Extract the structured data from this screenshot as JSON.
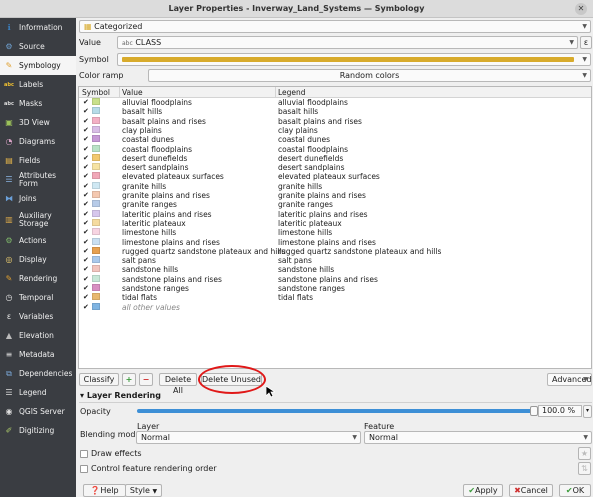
{
  "window": {
    "title": "Layer Properties - Inverway_Land_Systems — Symbology"
  },
  "sidebar": {
    "items": [
      {
        "label": "Information",
        "icon": "info-icon",
        "color": "#3b82c4"
      },
      {
        "label": "Source",
        "icon": "source-icon",
        "color": "#6fa0cf"
      },
      {
        "label": "Symbology",
        "icon": "paintbrush-icon",
        "color": "#e0a030"
      },
      {
        "label": "Labels",
        "icon": "labels-icon",
        "color": "#f0c030"
      },
      {
        "label": "Masks",
        "icon": "masks-icon",
        "color": "#dddddd"
      },
      {
        "label": "3D View",
        "icon": "cube-icon",
        "color": "#9cc25a"
      },
      {
        "label": "Diagrams",
        "icon": "diagrams-icon",
        "color": "#d9a3c6"
      },
      {
        "label": "Fields",
        "icon": "fields-icon",
        "color": "#e9b84a"
      },
      {
        "label": "Attributes Form",
        "icon": "form-icon",
        "color": "#8ab4e2"
      },
      {
        "label": "Joins",
        "icon": "joins-icon",
        "color": "#6ba0d9"
      },
      {
        "label": "Auxiliary Storage",
        "icon": "storage-icon",
        "color": "#d9a84a"
      },
      {
        "label": "Actions",
        "icon": "actions-icon",
        "color": "#7fb76a"
      },
      {
        "label": "Display",
        "icon": "display-icon",
        "color": "#f2d271"
      },
      {
        "label": "Rendering",
        "icon": "rendering-icon",
        "color": "#e0a030"
      },
      {
        "label": "Temporal",
        "icon": "clock-icon",
        "color": "#e2e2e2"
      },
      {
        "label": "Variables",
        "icon": "variables-icon",
        "color": "#e8e8e8"
      },
      {
        "label": "Elevation",
        "icon": "elevation-icon",
        "color": "#bbbbbb"
      },
      {
        "label": "Metadata",
        "icon": "metadata-icon",
        "color": "#dddddd"
      },
      {
        "label": "Dependencies",
        "icon": "dependencies-icon",
        "color": "#7aa7d6"
      },
      {
        "label": "Legend",
        "icon": "legend-icon",
        "color": "#dddddd"
      },
      {
        "label": "QGIS Server",
        "icon": "server-icon",
        "color": "#dddddd"
      },
      {
        "label": "Digitizing",
        "icon": "digitizing-icon",
        "color": "#aac86a"
      }
    ]
  },
  "renderer": {
    "type": "Categorized"
  },
  "value": {
    "label": "Value",
    "field_prefix": "abc",
    "field": "CLASS",
    "expr_icon": "ε"
  },
  "symbol": {
    "label": "Symbol",
    "color": "#d8ab2c"
  },
  "color_ramp": {
    "label": "Color ramp",
    "value": "Random colors"
  },
  "table": {
    "headers": {
      "symbol": "Symbol",
      "value": "Value",
      "legend": "Legend"
    },
    "rows": [
      {
        "value": "alluvial floodplains",
        "legend": "alluvial floodplains",
        "color": "#c8e08a"
      },
      {
        "value": "basalt hills",
        "legend": "basalt hills",
        "color": "#b6dce8"
      },
      {
        "value": "basalt plains and rises",
        "legend": "basalt plains and rises",
        "color": "#f3b0c4"
      },
      {
        "value": "clay plains",
        "legend": "clay plains",
        "color": "#d8bde6"
      },
      {
        "value": "coastal dunes",
        "legend": "coastal dunes",
        "color": "#c699d6"
      },
      {
        "value": "coastal floodplains",
        "legend": "coastal floodplains",
        "color": "#b9e3c6"
      },
      {
        "value": "desert dunefields",
        "legend": "desert dunefields",
        "color": "#f2c86e"
      },
      {
        "value": "desert sandplains",
        "legend": "desert sandplains",
        "color": "#f6e3a3"
      },
      {
        "value": "elevated plateaux surfaces",
        "legend": "elevated plateaux surfaces",
        "color": "#f1a7b8"
      },
      {
        "value": "granite hills",
        "legend": "granite hills",
        "color": "#cfe8f3"
      },
      {
        "value": "granite plains and rises",
        "legend": "granite plains and rises",
        "color": "#f4c8b0"
      },
      {
        "value": "granite ranges",
        "legend": "granite ranges",
        "color": "#b7cbe8"
      },
      {
        "value": "lateritic plains and rises",
        "legend": "lateritic plains and rises",
        "color": "#d6c6ec"
      },
      {
        "value": "lateritic plateaux",
        "legend": "lateritic plateaux",
        "color": "#f5dba0"
      },
      {
        "value": "limestone hills",
        "legend": "limestone hills",
        "color": "#f7d4e2"
      },
      {
        "value": "limestone plains and rises",
        "legend": "limestone plains and rises",
        "color": "#c9dff2"
      },
      {
        "value": "rugged quartz sandstone plateaux and hills",
        "legend": "rugged quartz sandstone plateaux and hills",
        "color": "#e6a050"
      },
      {
        "value": "salt pans",
        "legend": "salt pans",
        "color": "#a9c9ec"
      },
      {
        "value": "sandstone hills",
        "legend": "sandstone hills",
        "color": "#f2c5be"
      },
      {
        "value": "sandstone plains and rises",
        "legend": "sandstone plains and rises",
        "color": "#c7e8d8"
      },
      {
        "value": "sandstone ranges",
        "legend": "sandstone ranges",
        "color": "#d88fc2"
      },
      {
        "value": "tidal flats",
        "legend": "tidal flats",
        "color": "#e8b86e"
      }
    ],
    "other_label": "all other values",
    "other_color": "#7fb4e2"
  },
  "buttons": {
    "classify": "Classify",
    "delete_all": "Delete All",
    "delete_unused": "Delete Unused",
    "advanced": "Advanced",
    "help": "Help",
    "style": "Style",
    "apply": "Apply",
    "cancel": "Cancel",
    "ok": "OK"
  },
  "layer_rendering": {
    "header": "Layer Rendering",
    "opacity_label": "Opacity",
    "opacity_value": "100.0 %",
    "blending_label": "Blending mode",
    "layer_label": "Layer",
    "layer_value": "Normal",
    "feature_label": "Feature",
    "feature_value": "Normal",
    "draw_effects": "Draw effects",
    "control_order": "Control feature rendering order"
  }
}
